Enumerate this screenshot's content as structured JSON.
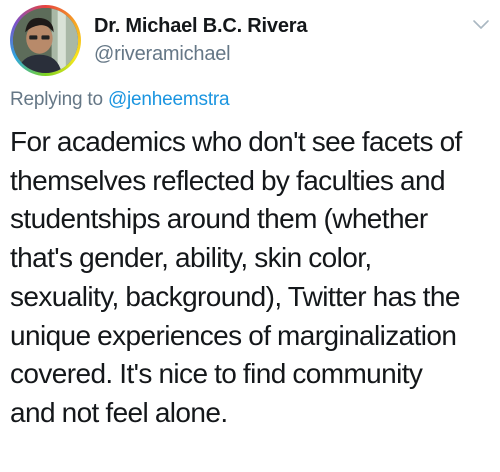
{
  "tweet": {
    "author": {
      "display_name": "Dr. Michael B.C. Rivera",
      "handle": "@riveramichael",
      "avatar_icon": "profile-photo-avatar"
    },
    "reply": {
      "prefix": "Replying to",
      "mention": "@jenheemstra"
    },
    "menu_icon": "chevron-down-icon",
    "body_lines": [
      "For academics who don't see facets of",
      "themselves reflected by faculties and",
      "studentships around them (whether",
      "that's gender, ability, skin color,",
      "sexuality, background), Twitter has the",
      "unique experiences of marginalization",
      "covered. It's nice to find community",
      "and not feel alone."
    ]
  },
  "colors": {
    "text": "#14171a",
    "secondary": "#657786",
    "link": "#1b95e0"
  }
}
